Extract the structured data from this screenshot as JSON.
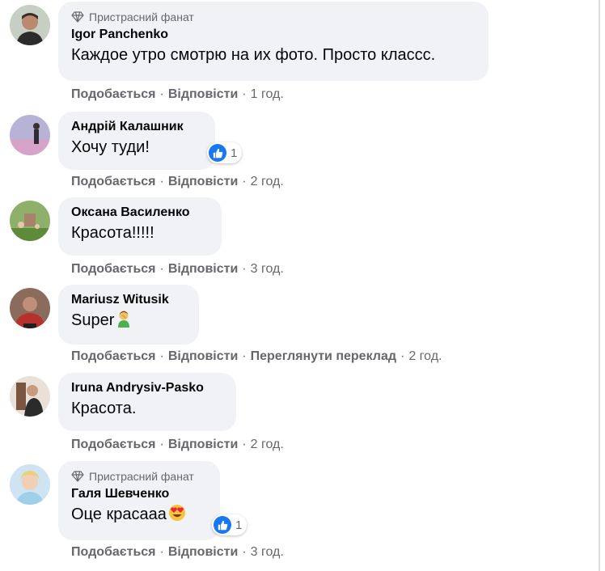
{
  "labels": {
    "like": "Подобається",
    "reply": "Відповісти",
    "translate": "Переглянути переклад",
    "dot": "·"
  },
  "colors": {
    "bubble": "#f0f2f5",
    "meta_text": "#65676b",
    "like_blue": "#1877f2"
  },
  "comments": [
    {
      "badge": "Пристрасний фанат",
      "author": "Igor Panchenko",
      "text": "Каждое утро смотрю на их фото. Просто классс.",
      "time": "1 год.",
      "avatar_icon": "avatar-photo"
    },
    {
      "author": "Андрій Калашник",
      "text": "Хочу туди!",
      "reaction_count": "1",
      "reaction_icon": "like-icon",
      "time": "2 год.",
      "avatar_icon": "avatar-photo"
    },
    {
      "author": "Оксана Василенко",
      "text": "Красота!!!!!",
      "time": "3 год.",
      "avatar_icon": "avatar-photo"
    },
    {
      "author": "Mariusz Witusik",
      "text": "Super",
      "emoji_icon": "person-facepalming-emoji",
      "time": "2 год.",
      "has_translate": true,
      "avatar_icon": "avatar-photo"
    },
    {
      "author": "Iruna Andrysiv-Pasko",
      "text": "Красота.",
      "time": "2 год.",
      "avatar_icon": "avatar-photo"
    },
    {
      "badge": "Пристрасний фанат",
      "author": "Галя Шевченко",
      "text": "Оце красааа",
      "emoji_icon": "heart-eyes-emoji",
      "reaction_count": "1",
      "reaction_icon": "like-icon",
      "time": "3 год.",
      "avatar_icon": "avatar-photo"
    }
  ]
}
